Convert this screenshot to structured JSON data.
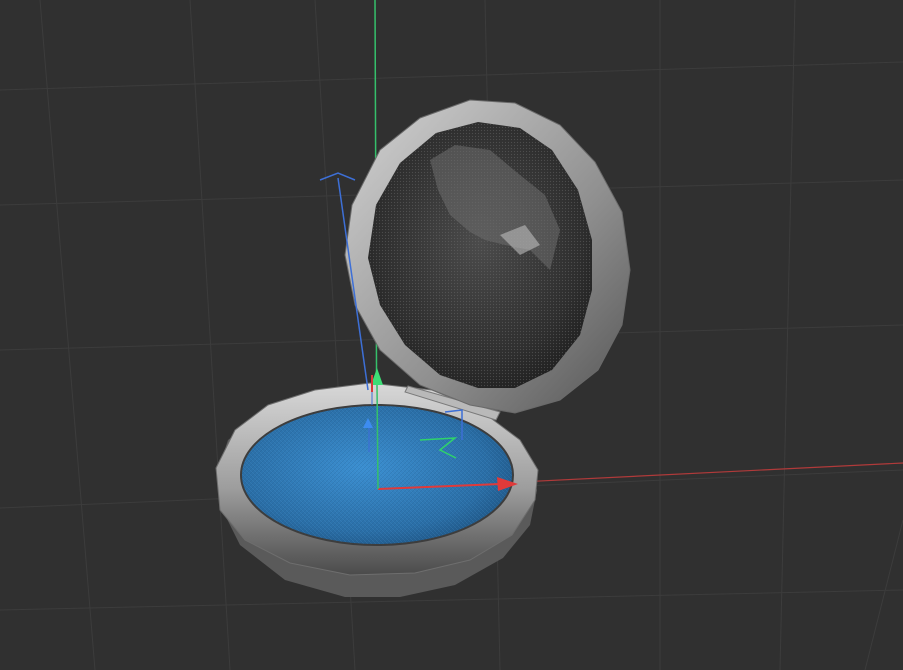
{
  "viewport": {
    "background_color": "#303030",
    "grid_color": "#3c3c3c",
    "x_axis_color": "#d8383b",
    "y_axis_color": "#3ddc76",
    "z_axis_color": "#3d6fd6"
  },
  "model": {
    "object": "compact-mirror",
    "rim_color": "#a7a7a7",
    "base_fill_color": "#2b6fa8",
    "mirror_color": "#3a3a3a"
  },
  "gizmo": {
    "mode": "translate",
    "handles": [
      "x-axis-arrow",
      "y-axis-arrow",
      "z-axis-arrow"
    ]
  }
}
